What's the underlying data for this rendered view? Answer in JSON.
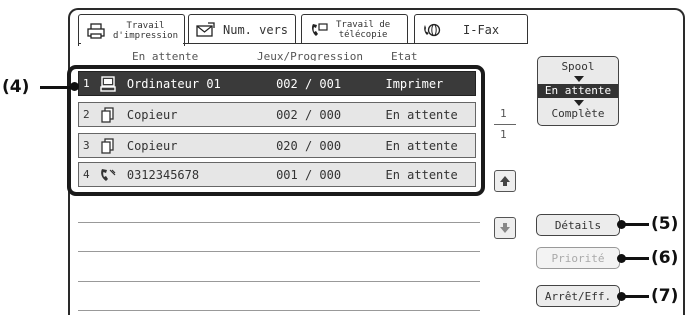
{
  "tabs": [
    {
      "label": "Travail\nd'impression",
      "icon": "printer-icon",
      "active": true
    },
    {
      "label": "Num. vers",
      "icon": "scan-send-icon",
      "active": false
    },
    {
      "label": "Travail de\ntélécopie",
      "icon": "fax-icon",
      "active": false
    },
    {
      "label": "I-Fax",
      "icon": "internet-fax-icon",
      "active": false
    }
  ],
  "columns": {
    "name": "En attente",
    "progress": "Jeux/Progression",
    "status": "Etat"
  },
  "jobs": [
    {
      "num": "1",
      "icon": "computer-job-icon",
      "name": "Ordinateur 01",
      "progress": "002 / 001",
      "status": "Imprimer",
      "selected": true
    },
    {
      "num": "2",
      "icon": "copy-job-icon",
      "name": "Copieur",
      "progress": "002 / 000",
      "status": "En attente",
      "selected": false
    },
    {
      "num": "3",
      "icon": "copy-job-icon",
      "name": "Copieur",
      "progress": "020 / 000",
      "status": "En attente",
      "selected": false
    },
    {
      "num": "4",
      "icon": "fax-job-icon",
      "name": "0312345678",
      "progress": "001 / 000",
      "status": "En attente",
      "selected": false
    }
  ],
  "pager": {
    "current": "1",
    "total": "1"
  },
  "spool": {
    "options": [
      "Spool",
      "En attente",
      "Complète"
    ],
    "selected": "En attente"
  },
  "buttons": {
    "details": "Détails",
    "priority": "Priorité",
    "stop_delete": "Arrêt/Eff."
  },
  "callouts": {
    "list": "(4)",
    "details": "(5)",
    "priority": "(6)",
    "stop": "(7)"
  }
}
